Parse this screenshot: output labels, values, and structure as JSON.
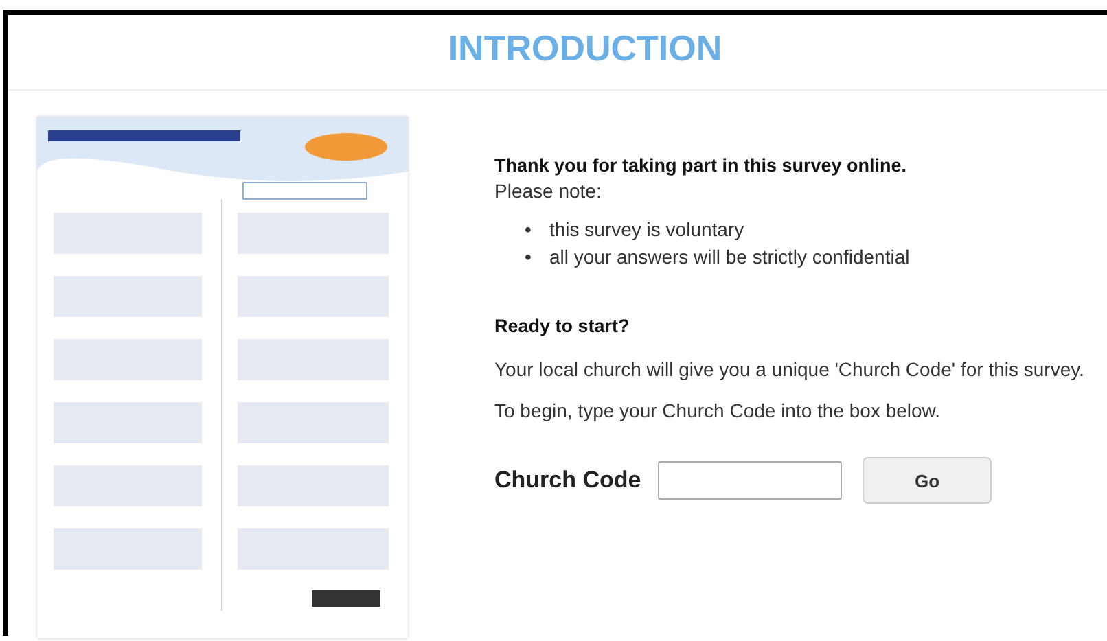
{
  "header": {
    "title": "INTRODUCTION"
  },
  "intro": {
    "heading": "Thank you for taking part in this survey online.",
    "note_label": "Please note:",
    "bullets": [
      {
        "marker": "•",
        "text": "this survey is voluntary"
      },
      {
        "marker": "•",
        "text": "all your answers will be strictly confidential"
      }
    ],
    "ready_heading": "Ready to start?",
    "paragraphs": [
      "Your local church will give you a unique 'Church Code' for this survey.",
      "To begin, type your Church Code into the box below."
    ]
  },
  "church_code": {
    "label": "Church Code",
    "button": "Go"
  }
}
